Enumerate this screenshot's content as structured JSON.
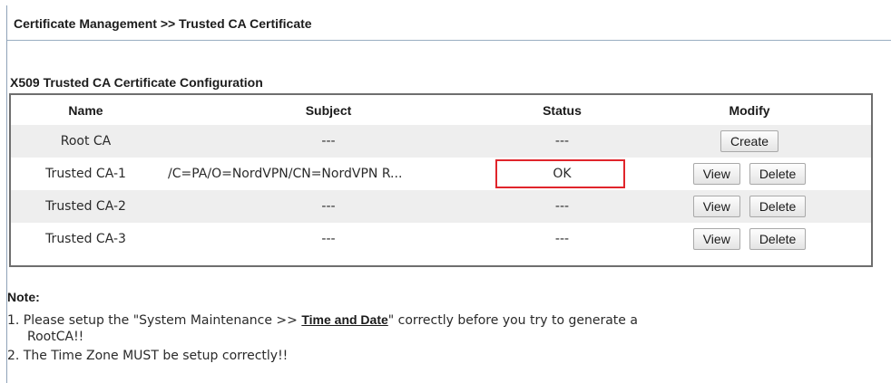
{
  "breadcrumb": "Certificate Management >> Trusted CA Certificate",
  "section_title": "X509 Trusted CA Certificate Configuration",
  "table": {
    "headers": [
      "Name",
      "Subject",
      "Status",
      "Modify"
    ],
    "rows": [
      {
        "name": "Root CA",
        "subject": "---",
        "status": "---",
        "buttons": [
          "Create"
        ]
      },
      {
        "name": "Trusted CA-1",
        "subject": "/C=PA/O=NordVPN/CN=NordVPN R...",
        "status": "OK",
        "buttons": [
          "View",
          "Delete"
        ]
      },
      {
        "name": "Trusted CA-2",
        "subject": "---",
        "status": "---",
        "buttons": [
          "View",
          "Delete"
        ]
      },
      {
        "name": "Trusted CA-3",
        "subject": "---",
        "status": "---",
        "buttons": [
          "View",
          "Delete"
        ]
      }
    ]
  },
  "note": {
    "title": "Note:",
    "line1_prefix": "1. Please setup the \"System Maintenance >> ",
    "line1_link": "Time and Date",
    "line1_suffix": "\" correctly before you try to generate a",
    "line1_cont": "RootCA!!",
    "line2": "2. The Time Zone MUST be setup correctly!!"
  },
  "colors": {
    "highlight": "#e0252b",
    "row_shade": "#eeeeee"
  }
}
